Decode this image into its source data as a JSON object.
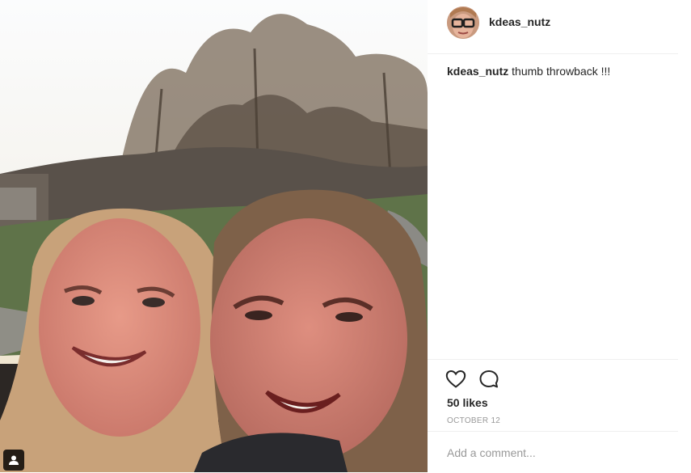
{
  "post": {
    "username": "kdeas_nutz",
    "caption_text": "thumb throwback !!!",
    "likes_text": "50 likes",
    "date_text": "OCTOBER 12"
  },
  "icons": {
    "like": "heart-outline-icon",
    "comment": "speech-bubble-icon",
    "tagged_users": "person-icon"
  },
  "comment_box": {
    "placeholder": "Add a comment..."
  },
  "colors": {
    "text": "#262626",
    "muted": "#999999",
    "divider": "#efefef"
  }
}
